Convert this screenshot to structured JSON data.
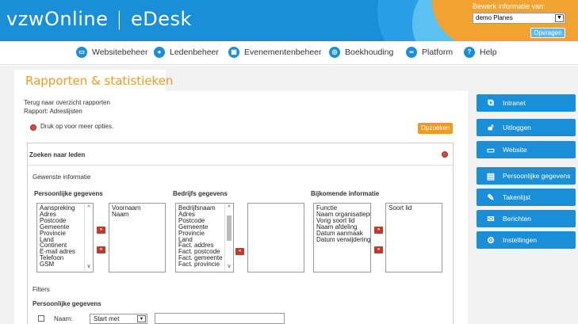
{
  "header": {
    "logo_vzw": "vzw",
    "logo_online": "Online",
    "logo_sep": "|",
    "logo_product": "eDesk",
    "bewerk_label": "Bewerk informatie van:",
    "org_select": "demo Planes",
    "opvragen_label": "Opvragen"
  },
  "nav": {
    "items": [
      {
        "label": "Websitebeheer",
        "icon": "monitor-icon"
      },
      {
        "label": "Ledenbeheer",
        "icon": "user-icon"
      },
      {
        "label": "Evenementenbeheer",
        "icon": "calendar-icon"
      },
      {
        "label": "Boekhouding",
        "icon": "coins-icon"
      },
      {
        "label": "Platform",
        "icon": "link-icon"
      },
      {
        "label": "Help",
        "icon": "help-icon"
      }
    ]
  },
  "page": {
    "tab_title": "Rapporten & statistieken",
    "back_link": "Terug naar overzicht rapporten",
    "report_label": "Rapport: Adreslijsten",
    "more_options": "Druk op voor meer opties.",
    "search_button": "Opzoeken"
  },
  "panel": {
    "title": "Zoeken naar leden",
    "gewenste": "Gewenste informatie",
    "persoonlijk_header": "Persoonlijke gegevens",
    "bedrijfs_header": "Bedrijfs gegevens",
    "bijkomend_header": "Bijkomende informatie",
    "persoonlijk_available": [
      "Aanspreking",
      "Adres",
      "Postcode",
      "Gemeente",
      "Provincie",
      "Land",
      "Continent",
      "E-mail adres",
      "Telefoon",
      "GSM"
    ],
    "persoonlijk_selected": [
      "Voornaam",
      "Naam"
    ],
    "bedrijfs_available": [
      "Bedrijfsnaam",
      "Adres",
      "Postcode",
      "Gemeente",
      "Provincie",
      "Land",
      "Fact. addres",
      "Fact. postcode",
      "Fact. gemeente",
      "Fact. provincie"
    ],
    "bedrijfs_selected": [],
    "bijkomend_available": [
      "Functie",
      "Naam organisatiepu",
      "Vorig soort lid",
      "Naam afdeling",
      "Datum aanmaak",
      "Datum verwijdering"
    ],
    "bijkomend_selected": [
      "Soort lid"
    ],
    "add_glyph": "»",
    "remove_glyph": "«",
    "filters_label": "Filters",
    "filter_persoonlijk": "Persoonlijke gegevens",
    "naam_label": "Naam:",
    "naam_operator": "Start met",
    "naam_value": ""
  },
  "sidebar": {
    "items": [
      {
        "label": "Intranet",
        "icon": "intranet-icon"
      },
      {
        "label": "Uitloggen",
        "icon": "lock-icon"
      },
      {
        "label": "Website",
        "icon": "monitor-icon"
      },
      {
        "label": "Persoonlijke gegevens",
        "icon": "id-card-icon"
      },
      {
        "label": "Takenlijst",
        "icon": "edit-icon"
      },
      {
        "label": "Berichten",
        "icon": "envelope-icon"
      },
      {
        "label": "Instellingen",
        "icon": "gear-icon"
      }
    ]
  },
  "colors": {
    "brand_blue": "#1a8fd8",
    "accent_orange": "#f29a20",
    "danger_red": "#c0392b"
  }
}
